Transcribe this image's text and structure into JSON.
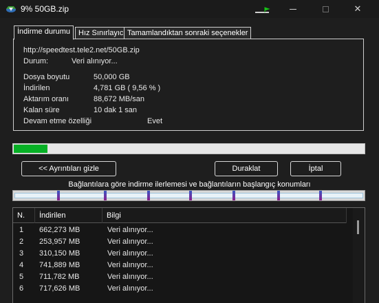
{
  "window": {
    "title": "9% 50GB.zip",
    "app_icon": "idm-icon",
    "tray_icon": "flag-icon",
    "controls": {
      "minimize": "minimize-icon",
      "maximize": "maximize-icon",
      "close": "✕"
    }
  },
  "tabs": [
    {
      "label": "İndirme durumu",
      "active": true
    },
    {
      "label": "Hız Sınırlayıcı",
      "active": false
    },
    {
      "label": "Tamamlandıktan sonraki seçenekler",
      "active": false
    }
  ],
  "status": {
    "url": "http://speedtest.tele2.net/50GB.zip",
    "state_label": "Durum:",
    "state_value": "Veri alınıyor...",
    "file_size_label": "Dosya boyutu",
    "file_size_value": "50,000  GB",
    "downloaded_label": "İndirilen",
    "downloaded_value": "4,781  GB  ( 9,56 % )",
    "transfer_rate_label": "Aktarım oranı",
    "transfer_rate_value": "88,672  MB/san",
    "time_left_label": "Kalan süre",
    "time_left_value": "10 dak 1 san",
    "resume_label": "Devam etme özelliği",
    "resume_value": "Evet"
  },
  "progress": {
    "fraction": 0.0956,
    "color": "#06b025"
  },
  "buttons": {
    "details": "<< Ayrıntıları gizle",
    "pause": "Duraklat",
    "cancel": "İptal"
  },
  "connections": {
    "caption": "Bağlantılara göre indirme ilerlemesi ve bağlantıların başlangıç konumları",
    "marker_positions": [
      0.12,
      0.255,
      0.38,
      0.5,
      0.625,
      0.755,
      0.875
    ],
    "marker_color": "#3a57c4"
  },
  "list": {
    "headers": [
      "N.",
      "İndirilen",
      "Bilgi"
    ],
    "rows": [
      {
        "n": "1",
        "downloaded": "662,273  MB",
        "info": "Veri alınıyor..."
      },
      {
        "n": "2",
        "downloaded": "253,957  MB",
        "info": "Veri alınıyor..."
      },
      {
        "n": "3",
        "downloaded": "310,150  MB",
        "info": "Veri alınıyor..."
      },
      {
        "n": "4",
        "downloaded": "741,889  MB",
        "info": "Veri alınıyor..."
      },
      {
        "n": "5",
        "downloaded": "711,782  MB",
        "info": "Veri alınıyor..."
      },
      {
        "n": "6",
        "downloaded": "717,626  MB",
        "info": "Veri alınıyor..."
      }
    ]
  }
}
